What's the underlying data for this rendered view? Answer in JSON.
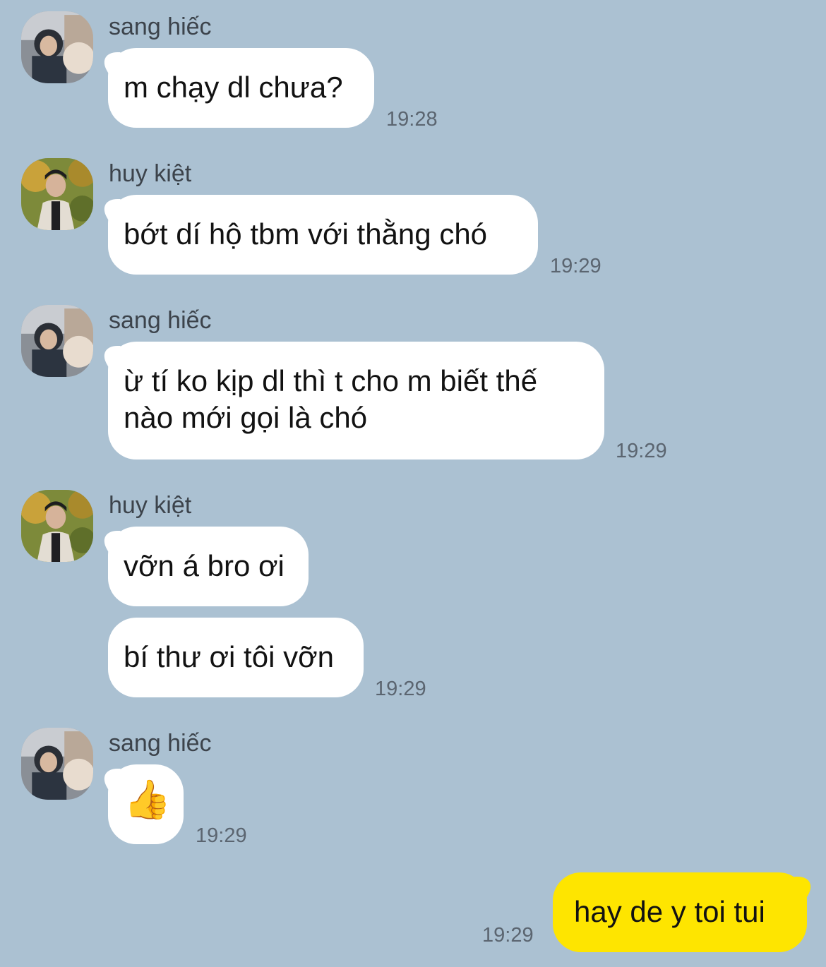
{
  "messages": [
    {
      "sender": "sang hiếc",
      "text": "m chạy dl chưa?",
      "time": "19:28"
    },
    {
      "sender": "huy kiệt",
      "text": "bớt dí hộ tbm với thằng chó",
      "time": "19:29"
    },
    {
      "sender": "sang hiếc",
      "text_line1": "ừ tí ko kịp dl thì t cho m biết thế",
      "text_line2": "nào mới gọi là chó",
      "time": "19:29"
    },
    {
      "sender": "huy kiệt",
      "text": "vỡn á bro ơi"
    },
    {
      "text": "bí thư ơi tôi vỡn",
      "time": "19:29"
    },
    {
      "sender": "sang hiếc",
      "text": "👍",
      "time": "19:29"
    },
    {
      "text": "hay de y toi tui",
      "time": "19:29",
      "mine": true
    }
  ],
  "colors": {
    "background": "#abc1d2",
    "incoming_bubble": "#ffffff",
    "outgoing_bubble": "#fee500"
  },
  "icons": {
    "thumbs_up": "thumbs-up-emoji"
  }
}
